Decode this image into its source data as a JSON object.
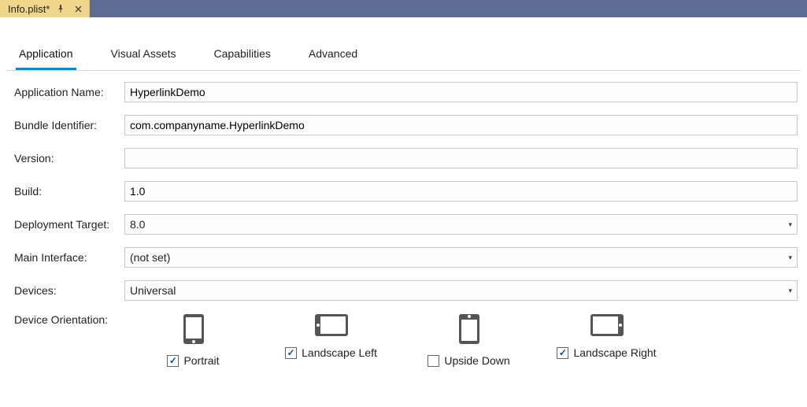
{
  "titlebar": {
    "tab_title": "Info.plist*"
  },
  "nav": {
    "items": [
      {
        "label": "Application",
        "active": true
      },
      {
        "label": "Visual Assets",
        "active": false
      },
      {
        "label": "Capabilities",
        "active": false
      },
      {
        "label": "Advanced",
        "active": false
      }
    ]
  },
  "form": {
    "application_name": {
      "label": "Application Name:",
      "value": "HyperlinkDemo"
    },
    "bundle_identifier": {
      "label": "Bundle Identifier:",
      "value": "com.companyname.HyperlinkDemo"
    },
    "version": {
      "label": "Version:",
      "value": ""
    },
    "build": {
      "label": "Build:",
      "value": "1.0"
    },
    "deployment_target": {
      "label": "Deployment Target:",
      "value": "8.0"
    },
    "main_interface": {
      "label": "Main Interface:",
      "value": "(not set)"
    },
    "devices": {
      "label": "Devices:",
      "value": "Universal"
    },
    "device_orientation": {
      "label": "Device Orientation:",
      "options": [
        {
          "label": "Portrait",
          "checked": true
        },
        {
          "label": "Landscape Left",
          "checked": true
        },
        {
          "label": "Upside Down",
          "checked": false
        },
        {
          "label": "Landscape Right",
          "checked": true
        }
      ]
    }
  }
}
